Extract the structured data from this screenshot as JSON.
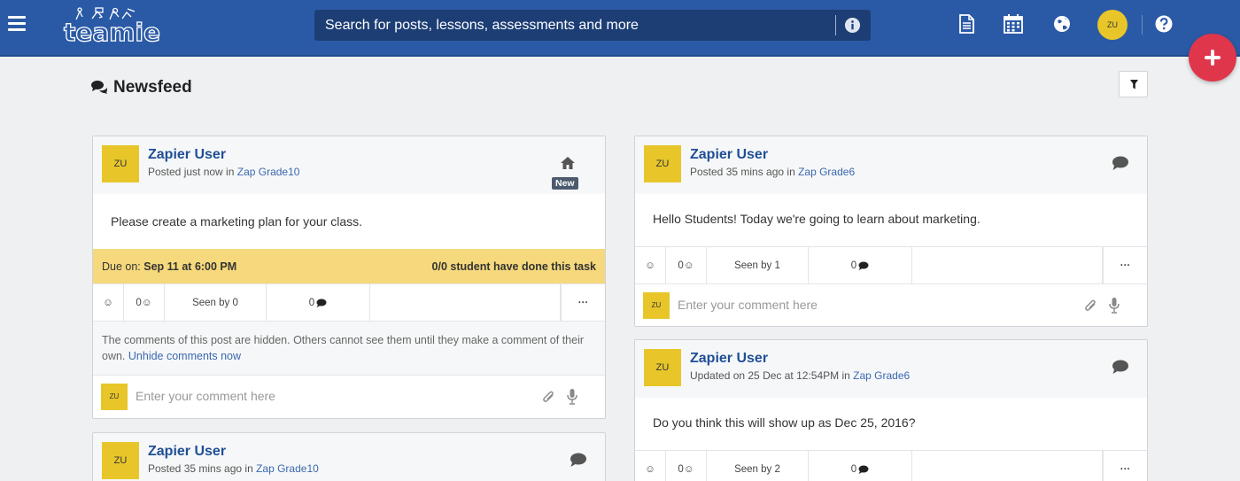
{
  "topbar": {
    "logo_text": "teamie",
    "search_placeholder": "Search for posts, lessons, assessments and more",
    "user_initials": "ZU",
    "icons": [
      "menu-icon",
      "info-icon",
      "document-icon",
      "calendar-icon",
      "globe-icon",
      "help-icon",
      "plus-icon"
    ]
  },
  "feed": {
    "title": "Newsfeed"
  },
  "posts": [
    {
      "initials": "ZU",
      "author": "Zapier User",
      "posted_prefix": "Posted just now in ",
      "group": "Zap Grade10",
      "badge": "New",
      "type_icon": "home-icon",
      "body": "Please create a marketing plan for your class.",
      "due_label": "Due on: ",
      "due_date": "Sep 11 at 6:00 PM",
      "task_status": "0/0 student have done this task",
      "reaction_count": "0",
      "seen": "Seen by 0",
      "comment_count": "0",
      "more": "···",
      "hidden_note": "The comments of this post are hidden. Others cannot see them until they make a comment of their own.",
      "unhide_link": "Unhide comments now",
      "comment_placeholder": "Enter your comment here"
    },
    {
      "initials": "ZU",
      "author": "Zapier User",
      "posted_prefix": "Posted 35 mins ago in ",
      "group": "Zap Grade6",
      "type_icon": "comment-icon",
      "body": "Hello Students! Today we're going to learn about marketing.",
      "reaction_count": "0",
      "seen": "Seen by 1",
      "comment_count": "0",
      "more": "···",
      "comment_placeholder": "Enter your comment here"
    },
    {
      "initials": "ZU",
      "author": "Zapier User",
      "posted_prefix": "Updated on 25 Dec at 12:54PM in ",
      "group": "Zap Grade6",
      "type_icon": "comment-icon",
      "body": "Do you think this will show up as Dec 25, 2016?",
      "reaction_count": "0",
      "seen": "Seen by 2",
      "comment_count": "0",
      "more": "···"
    },
    {
      "initials": "ZU",
      "author": "Zapier User",
      "posted_prefix": "Posted 35 mins ago in ",
      "group": "Zap Grade10",
      "type_icon": "comment-icon"
    }
  ],
  "colors": {
    "topbar": "#2a5aa6",
    "search": "#1d3e75",
    "avatar": "#e8c62a",
    "fab": "#e0364b",
    "due_bar": "#f6d97c",
    "link": "#3a68b0"
  }
}
